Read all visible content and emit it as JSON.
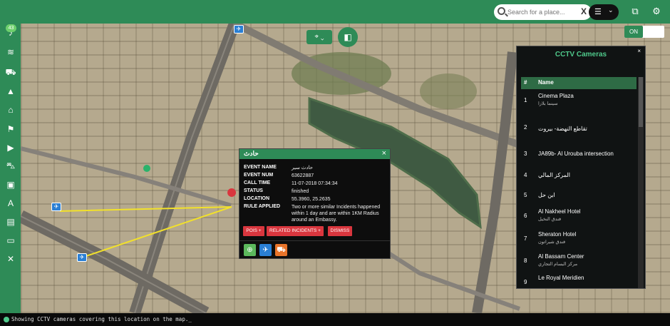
{
  "topbar": {
    "search_placeholder": "Search for a place...",
    "clear_glyph": "X",
    "layers_glyph": "☰",
    "dropdown_glyph": "⌄",
    "map_icon_glyph": "⧉",
    "settings_glyph": "⚙"
  },
  "sidebar": {
    "badge": "43",
    "icons": [
      "bell-icon",
      "layers-icon",
      "car-icon",
      "vehicle-icon",
      "building-icon",
      "hydrant-icon",
      "video-icon",
      "taxi-icon",
      "report-icon",
      "road-icon",
      "save-icon",
      "chat-icon",
      "tools-icon"
    ]
  },
  "map": {
    "fab_location_glyph": "⌖ ⌄",
    "fab_split_glyph": "◧",
    "toggle_label": "ON"
  },
  "popup": {
    "title": "حادث",
    "close_glyph": "×",
    "fields": [
      {
        "key": "EVENT NAME",
        "value": "حادث سير"
      },
      {
        "key": "EVENT NUM",
        "value": "63622887"
      },
      {
        "key": "CALL TIME",
        "value": "11-07-2018 07:34:34"
      },
      {
        "key": "STATUS",
        "value": "finished"
      },
      {
        "key": "LOCATION",
        "value": "55.3960, 25.2635"
      },
      {
        "key": "RULE APPLIED",
        "value": "Two or more similar Incidents happened within 1 day and are within 1KM Radius around an Embassy."
      }
    ],
    "buttons": {
      "pois": "POIS +",
      "related": "RELATED INCIDENTS +",
      "dismiss": "DISMISS"
    }
  },
  "cctv": {
    "title": "CCTV Cameras",
    "close_glyph": "×",
    "col_num": "#",
    "col_name": "Name",
    "rows": [
      {
        "num": "1",
        "name": "Cinema Plaza",
        "sub": "سينما بلازا"
      },
      {
        "num": "2",
        "name": "تقاطع النهضة- بيروت",
        "sub": ""
      },
      {
        "num": "3",
        "name": "JA89b- Al Urouba intersection",
        "sub": ""
      },
      {
        "num": "4",
        "name": "المركز المالي",
        "sub": ""
      },
      {
        "num": "5",
        "name": "ابن حل",
        "sub": ""
      },
      {
        "num": "6",
        "name": "Al Nakheel Hotel",
        "sub": "فندق النخيل"
      },
      {
        "num": "7",
        "name": "Sheraton Hotel",
        "sub": "فندق شيراتون"
      },
      {
        "num": "8",
        "name": "Al Bassam Center",
        "sub": "مركز البسام التجاري"
      },
      {
        "num": "9",
        "name": "Le Royal Meridien",
        "sub": ""
      }
    ]
  },
  "status": {
    "message": "Showing CCTV cameras covering this location on the map._"
  },
  "colors": {
    "brand_green": "#2e8b57",
    "danger_red": "#d9363e",
    "camera_blue": "#2a7fd4",
    "link_line": "#f2e12a"
  }
}
